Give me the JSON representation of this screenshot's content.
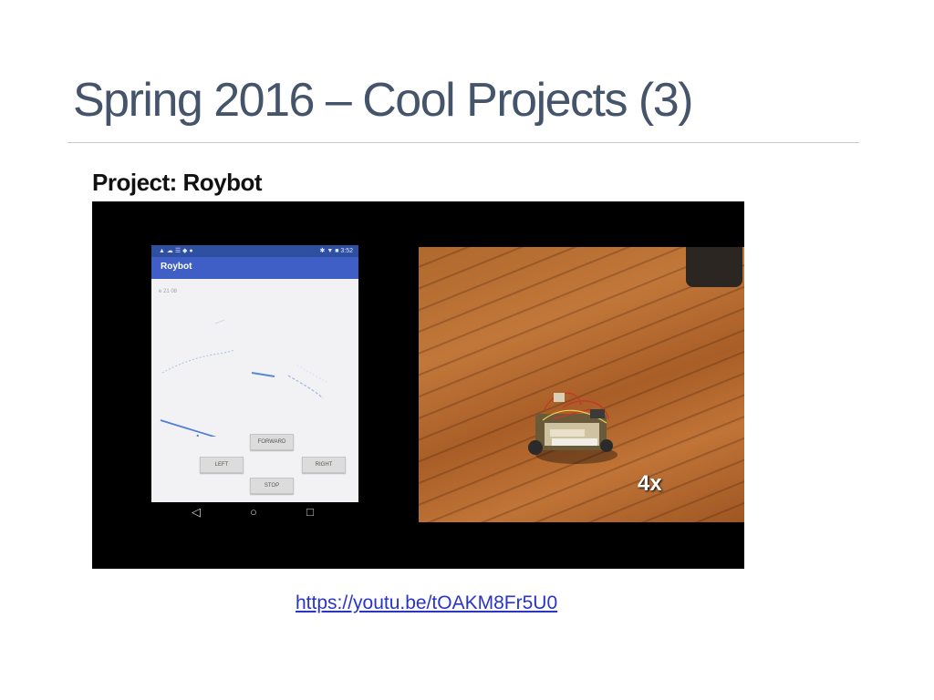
{
  "slide": {
    "title": "Spring 2016 – Cool Projects (3)",
    "subtitle": "Project: Roybot",
    "link": "https://youtu.be/tOAKM8Fr5U0"
  },
  "video": {
    "app": {
      "status_icons": "▲ ☁ ☰ ◆ ●",
      "status_right": "✱ ▼ ■ 3:52",
      "title": "Roybot",
      "coordinate": "e 21 08",
      "buttons": {
        "forward": "FORWARD",
        "left": "LEFT",
        "right": "RIGHT",
        "stop": "STOP"
      },
      "nav_icons": [
        "back-icon",
        "home-icon",
        "recents-icon"
      ]
    },
    "speed_label": "4x"
  },
  "colors": {
    "title": "#44546a",
    "link": "#2a35c7",
    "app_bar": "#3f5fc6",
    "status_bar": "#2f4fa0"
  }
}
